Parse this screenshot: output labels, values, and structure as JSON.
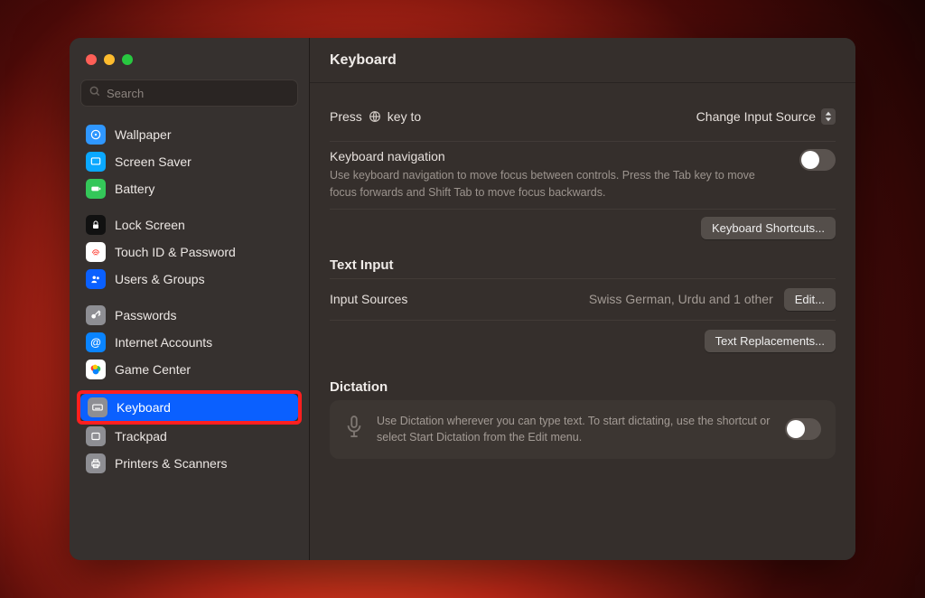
{
  "sidebar": {
    "search_placeholder": "Search",
    "groups": [
      {
        "items": [
          {
            "key": "wallpaper",
            "label": "Wallpaper"
          },
          {
            "key": "screen-saver",
            "label": "Screen Saver"
          },
          {
            "key": "battery",
            "label": "Battery"
          }
        ]
      },
      {
        "items": [
          {
            "key": "lock-screen",
            "label": "Lock Screen"
          },
          {
            "key": "touch-id",
            "label": "Touch ID & Password"
          },
          {
            "key": "users",
            "label": "Users & Groups"
          }
        ]
      },
      {
        "items": [
          {
            "key": "passwords",
            "label": "Passwords"
          },
          {
            "key": "internet",
            "label": "Internet Accounts"
          },
          {
            "key": "game-center",
            "label": "Game Center"
          }
        ]
      },
      {
        "items": [
          {
            "key": "keyboard",
            "label": "Keyboard",
            "selected": true,
            "highlighted": true
          },
          {
            "key": "trackpad",
            "label": "Trackpad"
          },
          {
            "key": "printers",
            "label": "Printers & Scanners"
          }
        ]
      }
    ]
  },
  "main": {
    "title": "Keyboard",
    "globe_row": {
      "label_prefix": "Press",
      "label_suffix": "key to",
      "value": "Change Input Source"
    },
    "kb_nav": {
      "title": "Keyboard navigation",
      "desc": "Use keyboard navigation to move focus between controls. Press the Tab key to move focus forwards and Shift Tab to move focus backwards.",
      "enabled": false
    },
    "shortcuts_button": "Keyboard Shortcuts...",
    "text_input": {
      "section": "Text Input",
      "input_sources_label": "Input Sources",
      "input_sources_value": "Swiss German, Urdu and 1 other",
      "edit_button": "Edit...",
      "text_replacements_button": "Text Replacements..."
    },
    "dictation": {
      "section": "Dictation",
      "desc": "Use Dictation wherever you can type text. To start dictating, use the shortcut or select Start Dictation from the Edit menu.",
      "enabled": false
    }
  }
}
